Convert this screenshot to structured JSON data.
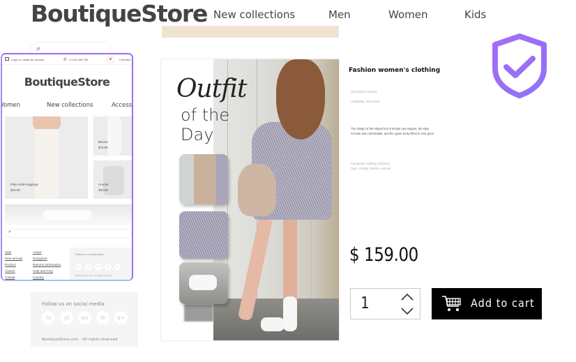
{
  "header": {
    "logo": "BoutiqueStore",
    "nav": [
      "New collections",
      "Men",
      "Women",
      "Kids"
    ]
  },
  "background_search": {
    "icon": "search-icon"
  },
  "preview": {
    "topbar": {
      "login": "Login or create an account",
      "phone": "+0 123 456-789",
      "favorites": "Favorites"
    },
    "logo": "BoutiqueStore",
    "nav": [
      "Women",
      "New collections",
      "Accessories"
    ],
    "tiles": [
      {
        "name": "Plain white leggings",
        "price": "$19.99"
      },
      {
        "name": "Blouse",
        "price": "$70.99"
      },
      {
        "name": "Hoodie",
        "price": "$30.99"
      }
    ],
    "links_col1": [
      "Sale",
      "New arrivals",
      "Product",
      "Classic",
      "Casual"
    ],
    "links_col2": [
      "Active",
      "Designers",
      "Returns Information",
      "Help and FAQ",
      "Country"
    ],
    "social": {
      "title": "Follow us on social media",
      "icons": [
        "tv",
        "yt",
        "on",
        "lb",
        "q+"
      ],
      "copyright": "BoutiqueStore.com - All rights reserved"
    }
  },
  "social_panel": {
    "title": "Follow us on social media",
    "icons": [
      "tv",
      "yt",
      "on",
      "lb",
      "q+"
    ],
    "copyright": "BoutiqueStore.com - All rights reserved"
  },
  "banner": {
    "script_title": "Outfit",
    "line1": "of the",
    "line2": "Day"
  },
  "product": {
    "title": "Fashion women's clothing",
    "reviews": "(2)customer reviews",
    "availability_label": "Availability:",
    "availability_value": "35 in stock",
    "description_line1": "The design of the striped knit is simple and elegant, the style",
    "description_line2": "is loose and comfortable, and the upper body effect is very good",
    "categories": "Categories: clothing, Womens",
    "tags": "Tags: clothing, fashion, women",
    "price": "$ 159.00",
    "quantity": "1",
    "add_to_cart": "Add to cart"
  },
  "colors": {
    "shield_accent": "#a06ff5",
    "beige": "#f0e4d1",
    "cart_button": "#000000",
    "availability_green": "#7cc47c"
  }
}
